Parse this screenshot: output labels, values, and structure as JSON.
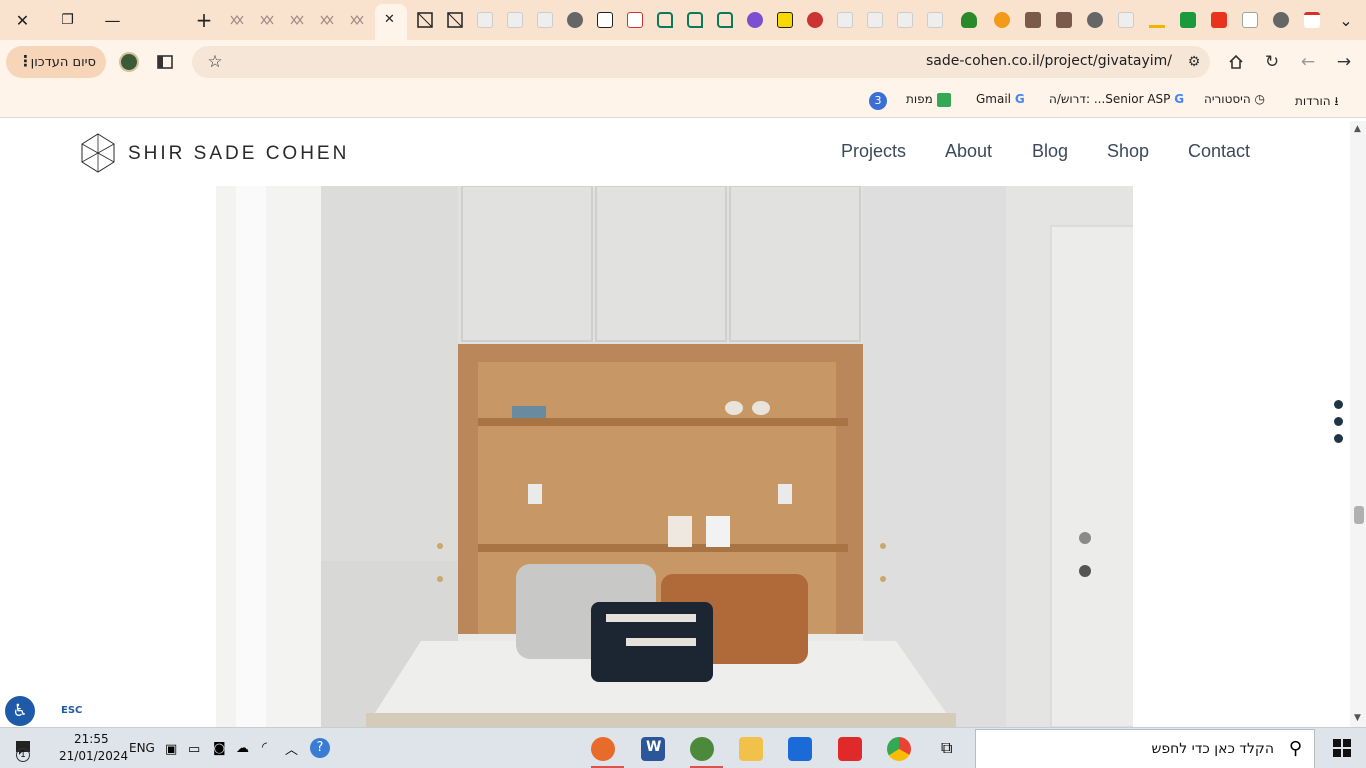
{
  "browser": {
    "window_controls": {
      "close": "✕",
      "restore": "❐",
      "minimize": "—"
    },
    "new_tab": "+",
    "tab_search": "⌄",
    "active_tab_close": "✕",
    "profile_label": "סיום העדכון",
    "url": "sade-cohen.co.il/project/givatayim/",
    "bookmarks": [
      {
        "label": "הורדות",
        "icon": "download-icon"
      },
      {
        "label": "היסטוריה",
        "icon": "history-icon"
      },
      {
        "label": "דרוש/ה: ...Senior ASP",
        "icon": "google-icon"
      },
      {
        "label": "Gmail",
        "icon": "google-icon"
      },
      {
        "label": "מפות",
        "icon": "maps-icon"
      },
      {
        "label": "3",
        "icon": "badge-icon"
      }
    ]
  },
  "site": {
    "logo": "SHIR SADE COHEN",
    "nav": [
      "Projects",
      "About",
      "Blog",
      "Shop",
      "Contact"
    ]
  },
  "accessibility": {
    "esc": "ESC"
  },
  "taskbar": {
    "search_placeholder": "הקלד כאן כדי לחפש",
    "time": "21:55",
    "date": "21/01/2024",
    "lang": "ENG",
    "notification_count": "1"
  },
  "colors": {
    "tab_strip": "#f9e3cf",
    "toolbar": "#fff4ea",
    "nav_text": "#3a4a5a",
    "dots": "#1f3545"
  }
}
